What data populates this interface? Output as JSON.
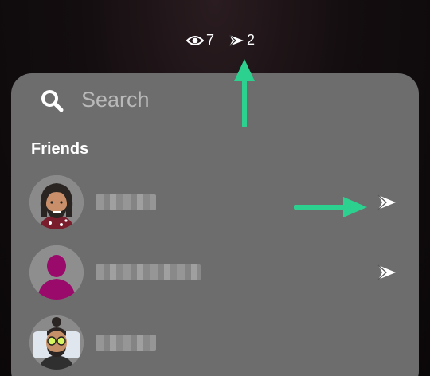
{
  "stats": {
    "views_icon": "eye-icon",
    "views_count": "7",
    "screenshots_icon": "send-arrow-icon",
    "screenshots_count": "2"
  },
  "search": {
    "icon": "search-icon",
    "placeholder": "Search"
  },
  "friends": {
    "title": "Friends",
    "items": [
      {
        "name": "",
        "avatar": "bitmoji-long-hair-beard",
        "action_icon": "send-arrow-icon"
      },
      {
        "name": "",
        "avatar": "default-silhouette-magenta",
        "action_icon": "send-arrow-icon"
      },
      {
        "name": "",
        "avatar": "bitmoji-bun-glasses",
        "action_icon": ""
      }
    ]
  },
  "colors": {
    "panel": "#6d6d6d",
    "annotation_arrow": "#2dd18f",
    "silhouette": "#9a0a6a"
  }
}
